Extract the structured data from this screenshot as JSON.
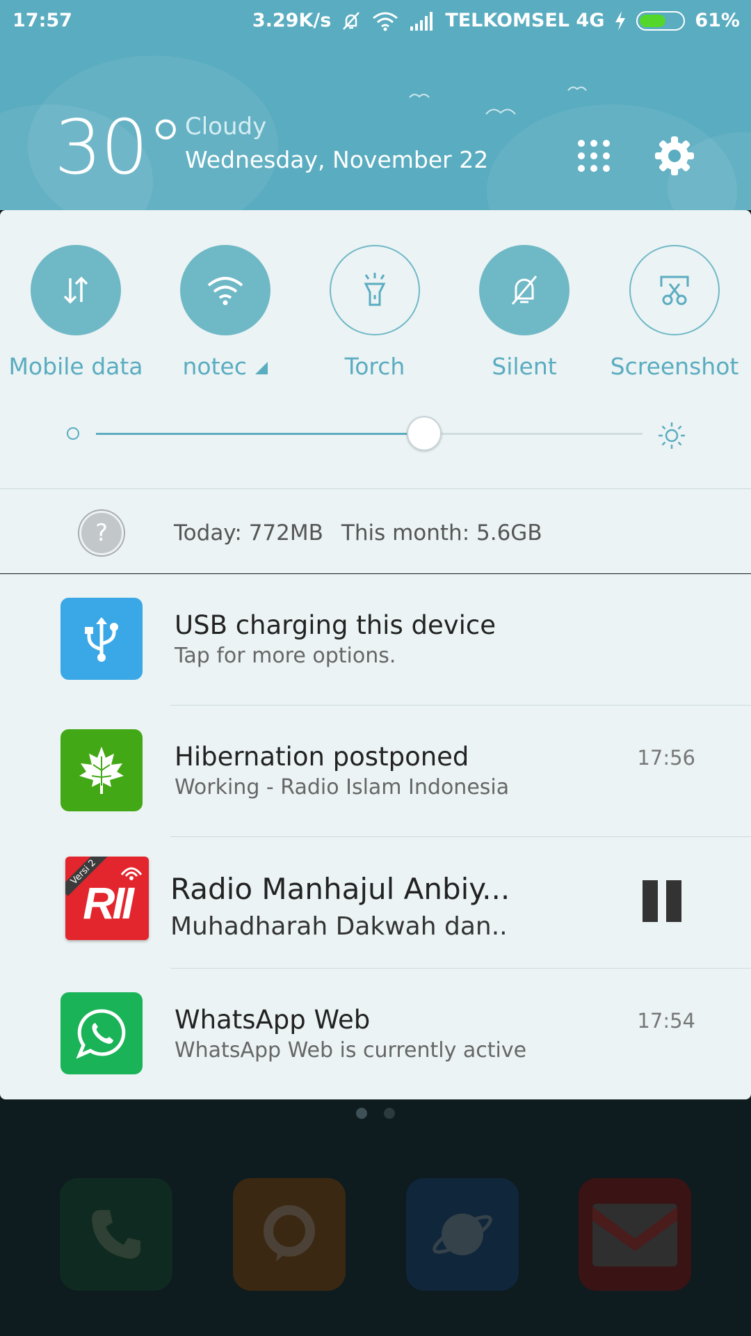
{
  "status_bar": {
    "time": "17:57",
    "speed": "3.29K/s",
    "carrier": "TELKOMSEL 4G",
    "battery_percent": "61%",
    "battery_level": 0.61
  },
  "weather": {
    "temperature": "30°",
    "condition": "Cloudy",
    "date": "Wednesday, November 22"
  },
  "quick_toggles": [
    {
      "label": "Mobile data",
      "state": "on",
      "icon": "data-arrows-icon"
    },
    {
      "label": "notec",
      "state": "on",
      "icon": "wifi-icon"
    },
    {
      "label": "Torch",
      "state": "off",
      "icon": "torch-icon"
    },
    {
      "label": "Silent",
      "state": "on",
      "icon": "bell-slash-icon"
    },
    {
      "label": "Screenshot",
      "state": "off",
      "icon": "scissors-icon"
    }
  ],
  "brightness": {
    "level": 0.6
  },
  "data_usage": {
    "help_icon": "?",
    "today": "Today: 772MB",
    "month": "This month: 5.6GB"
  },
  "notifications": [
    {
      "title": "USB charging this device",
      "subtitle": "Tap for more options.",
      "time": "",
      "icon": "usb-icon",
      "color": "#3aa7e6"
    },
    {
      "title": "Hibernation postponed",
      "subtitle": "Working - Radio Islam Indonesia",
      "time": "17:56",
      "icon": "maple-leaf-icon",
      "color": "#43a815"
    },
    {
      "title": "Radio Manhajul Anbiy...",
      "subtitle": "Muhadharah Dakwah dan..",
      "time": "",
      "icon": "rii-logo",
      "logo_text": "RII",
      "logo_badge": "Versi 2",
      "color": "#e3262d"
    },
    {
      "title": "WhatsApp Web",
      "subtitle": "WhatsApp Web is currently active",
      "time": "17:54",
      "icon": "whatsapp-icon",
      "color": "#1ab357"
    }
  ],
  "dock": [
    {
      "name": "phone-app",
      "icon": "phone-icon",
      "color": "#0f2a20"
    },
    {
      "name": "messages-app",
      "icon": "chat-icon",
      "color": "#3b2812"
    },
    {
      "name": "browser-app",
      "icon": "planet-icon",
      "color": "#10263a"
    },
    {
      "name": "gmail-app",
      "icon": "gmail-icon",
      "color": "#3a1414"
    }
  ]
}
